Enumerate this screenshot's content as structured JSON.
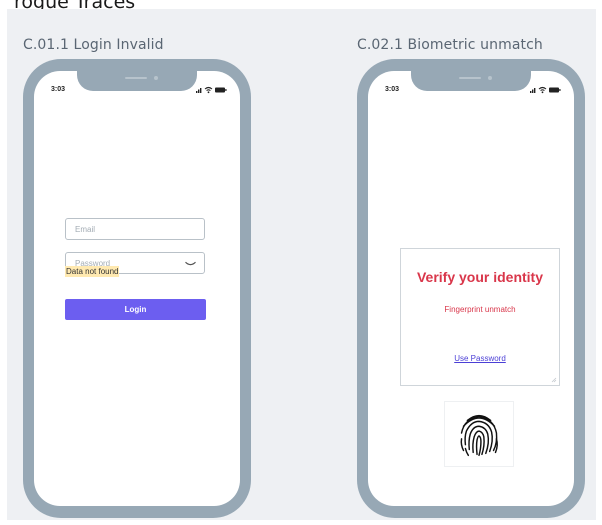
{
  "page": {
    "heading": "rogue Traces"
  },
  "frames": [
    {
      "title": "C.01.1 Login Invalid",
      "status_bar": {
        "time": "3:03"
      },
      "email_field": {
        "placeholder": "Email",
        "value": ""
      },
      "password_field": {
        "placeholder": "Password",
        "value": ""
      },
      "error_message": "Data not found",
      "login_button_label": "Login"
    },
    {
      "title": "C.02.1 Biometric unmatch",
      "status_bar": {
        "time": "3:03"
      },
      "verify_card": {
        "title": "Verify your identity",
        "subtitle": "Fingerprint unmatch",
        "link_label": "Use Password"
      },
      "fingerprint_icon": "fingerprint-icon"
    }
  ],
  "icons": {
    "status": [
      "signal-icon",
      "wifi-icon",
      "battery-icon"
    ],
    "password_toggle": "eye-closed-icon"
  },
  "colors": {
    "board_background": "#eef0f3",
    "phone_frame": "#97a8b5",
    "primary_button": "#6c5ef0",
    "error_highlight": "#ffe9b0",
    "error_text": "#d9364a",
    "link": "#4b3fd6"
  }
}
